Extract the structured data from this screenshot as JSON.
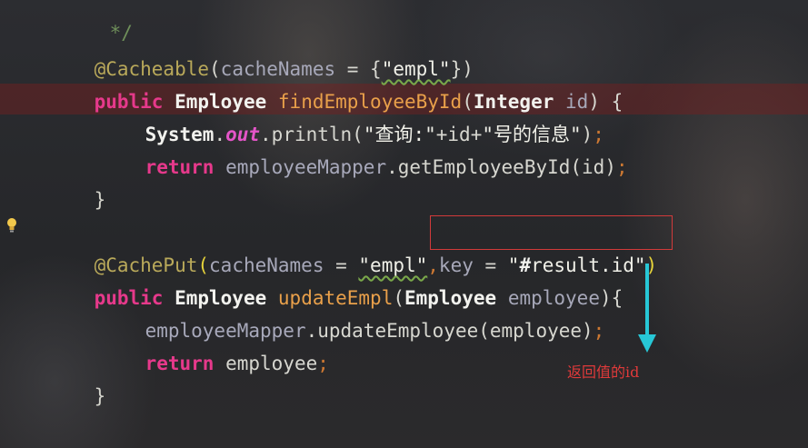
{
  "code": {
    "comment_end": "*/",
    "l1": {
      "ann": "@Cacheable",
      "open": "(",
      "p": "cacheNames",
      "eq": " = ",
      "b": "{",
      "s": "\"empl\"",
      "close": "})"
    },
    "l2": {
      "kw": "public",
      "type": "Employee",
      "fn": "findEmployeeById",
      "o": "(",
      "ptype": "Integer",
      "param": "id",
      "c": ") {"
    },
    "l3": {
      "cls": "System",
      "dot": ".",
      "field": "out",
      "call": ".println(",
      "s1": "\"查询:\"",
      "plus": "+id+",
      "s2": "\"号的信息\"",
      "end": ")",
      "semi": ";"
    },
    "l4": {
      "kw": "return",
      "obj": "employeeMapper",
      "call": ".getEmployeeById(id)",
      "semi": ";"
    },
    "l5": "}",
    "l7": {
      "ann": "@CachePut",
      "open": "(",
      "p": "cacheNames",
      "eq": " = ",
      "s": "\"empl\"",
      "comma": ",",
      "key": "key",
      "eq2": " = ",
      "s2a": "\"",
      "hash": "#",
      "s2b": "result.id\"",
      "close": ")"
    },
    "l8": {
      "kw": "public",
      "type": "Employee",
      "fn": "updateEmpl",
      "o": "(",
      "ptype": "Employee",
      "param": "employee",
      "c": "){"
    },
    "l9": {
      "obj": "employeeMapper",
      "call": ".updateEmployee(employee)",
      "semi": ";"
    },
    "l10": {
      "kw": "return",
      "var": "employee",
      "semi": ";"
    },
    "l11": "}"
  },
  "annotation": {
    "note": "返回值的id",
    "box_color": "#d23a3a",
    "arrow_color": "#27c7d6"
  }
}
